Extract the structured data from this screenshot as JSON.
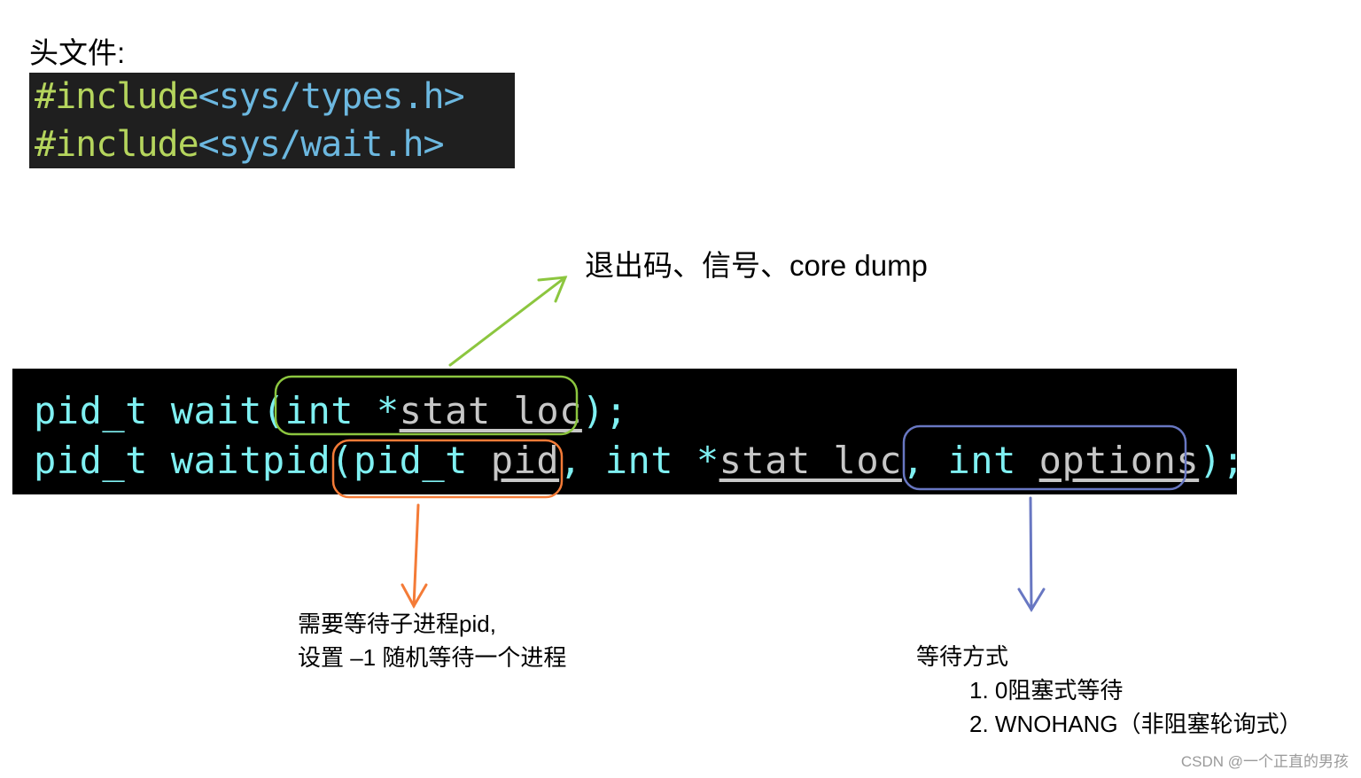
{
  "header": {
    "label": "头文件:"
  },
  "includes": [
    {
      "directive": "#include",
      "path": "<sys/types.h>"
    },
    {
      "directive": "#include",
      "path": "<sys/wait.h>"
    }
  ],
  "code": {
    "wait": {
      "ret": "pid_t",
      "name": "wait(",
      "type": "int *",
      "param": "stat_loc",
      "end": ");"
    },
    "waitpid": {
      "ret": "pid_t",
      "name": "waitpid(",
      "p1_type": "pid_t ",
      "p1": "pid",
      "sep1": ", ",
      "p2_type": "int *",
      "p2": "stat_loc",
      "sep2": ", ",
      "p3_type": "int ",
      "p3": "options",
      "end": ");"
    }
  },
  "annotations": {
    "status": {
      "text": "退出码、信号、core dump",
      "color": "#8cc63f"
    },
    "pid": {
      "lines": [
        "需要等待子进程pid,",
        "设置 –1 随机等待一个进程"
      ],
      "color": "#f47b37"
    },
    "options": {
      "title": "等待方式",
      "items": [
        "1. 0阻塞式等待",
        "2. WNOHANG（非阻塞轮询式）"
      ],
      "color": "#6877c2"
    }
  },
  "watermark": "CSDN @一个正直的男孩"
}
